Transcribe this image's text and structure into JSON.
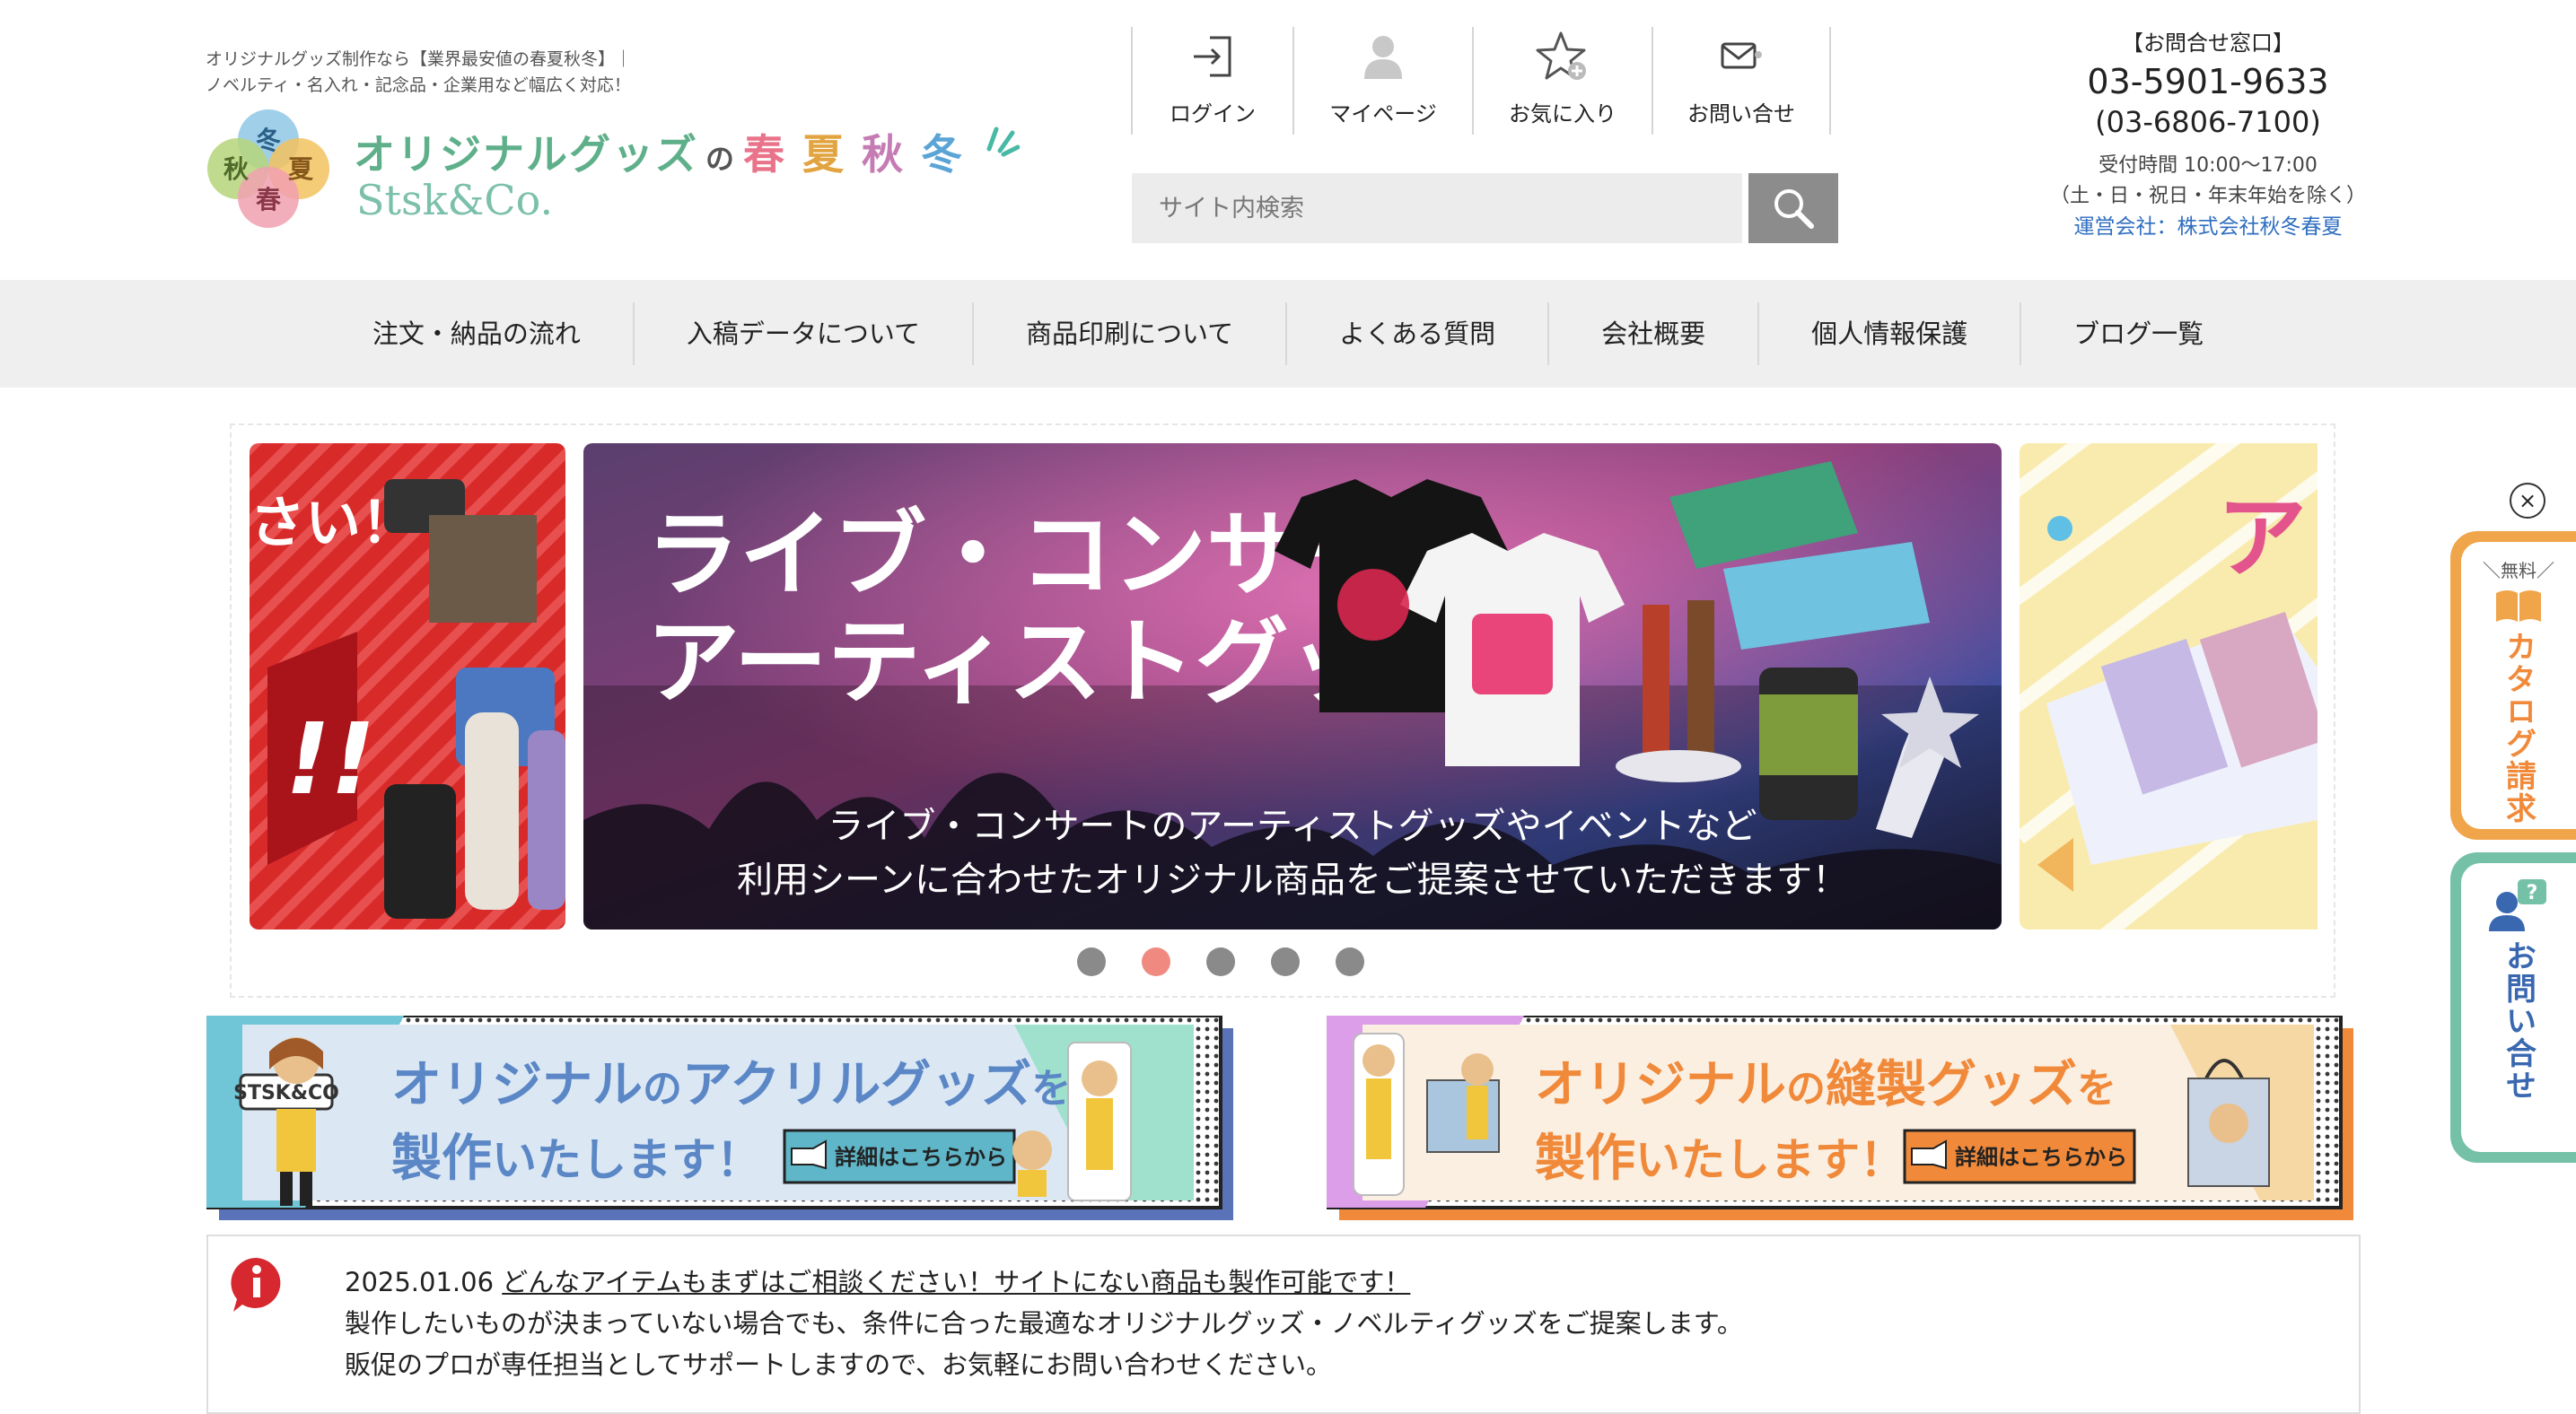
{
  "header": {
    "tagline_line1": "オリジナルグッズ制作なら【業界最安値の春夏秋冬】｜",
    "tagline_line2": "ノベルティ・名入れ・記念品・企業用など幅広く対応！",
    "logo": {
      "mark_chars": [
        "冬",
        "秋",
        "夏",
        "春"
      ],
      "jp_word": "オリジナルグッズ",
      "jp_no": "の",
      "jp_seasons": [
        "春",
        "夏",
        "秋",
        "冬"
      ],
      "en": "Stsk&Co."
    }
  },
  "icon_nav": [
    {
      "label": "ログイン",
      "icon": "login-icon"
    },
    {
      "label": "マイページ",
      "icon": "user-icon"
    },
    {
      "label": "お気に入り",
      "icon": "favorite-star-icon"
    },
    {
      "label": "お問い合せ",
      "icon": "mail-icon"
    }
  ],
  "search": {
    "placeholder": "サイト内検索",
    "value": ""
  },
  "contact": {
    "label": "【お問合せ窓口】",
    "tel1": "03-5901-9633",
    "tel2": "(03-6806-7100)",
    "hours1": "受付時間 10:00〜17:00",
    "hours2": "（土・日・祝日・年末年始を除く）",
    "company": "運営会社：株式会社秋冬春夏"
  },
  "global_nav": [
    "注文・納品の流れ",
    "入稿データについて",
    "商品印刷について",
    "よくある質問",
    "会社概要",
    "個人情報保護",
    "ブログ一覧"
  ],
  "slider": {
    "left_text": "さい！",
    "left_mark": "!!",
    "main_title1": "ライブ・コンサート",
    "main_title2": "アーティストグッズ",
    "main_sub1": "ライブ・コンサートのアーティストグッズやイベントなど",
    "main_sub2": "利用シーンに合わせたオリジナル商品をご提案させていただきます！",
    "right_text": "ア",
    "dots": 5,
    "active_dot": 2
  },
  "banners": {
    "acrylic": {
      "badge": "STSK&CO",
      "line1_a": "オリジナル",
      "line1_b": "の",
      "line1_c": "アクリルグッズ",
      "line1_d": "を",
      "line2_a": "製作",
      "line2_b": "いたします！",
      "button": "詳細はこちらから"
    },
    "sewing": {
      "line1_a": "オリジナル",
      "line1_b": "の",
      "line1_c": "縫製グッズ",
      "line1_d": "を",
      "line2_a": "製作",
      "line2_b": "いたします！",
      "button": "詳細はこちらから"
    }
  },
  "news": {
    "date": "2025.01.06",
    "title": "どんなアイテムもまずはご相談ください！サイトにない商品も製作可能です！",
    "line2": "製作したいものが決まっていない場合でも、条件に合った最適なオリジナルグッズ・ノベルティグッズをご提案します。",
    "line3": "販促のプロが専任担当としてサポートしますので、お気軽にお問い合わせください。"
  },
  "side_tabs": {
    "close": "×",
    "catalog": {
      "badge": "＼無料／",
      "label": "カタログ請求"
    },
    "inquiry": {
      "badge": "?",
      "label": "お問い合せ"
    }
  },
  "colors": {
    "accent_blue": "#2f6ec0",
    "catalog_orange": "#f0a54a",
    "inquiry_teal": "#74c1a7",
    "dot_active": "#f08a80"
  }
}
